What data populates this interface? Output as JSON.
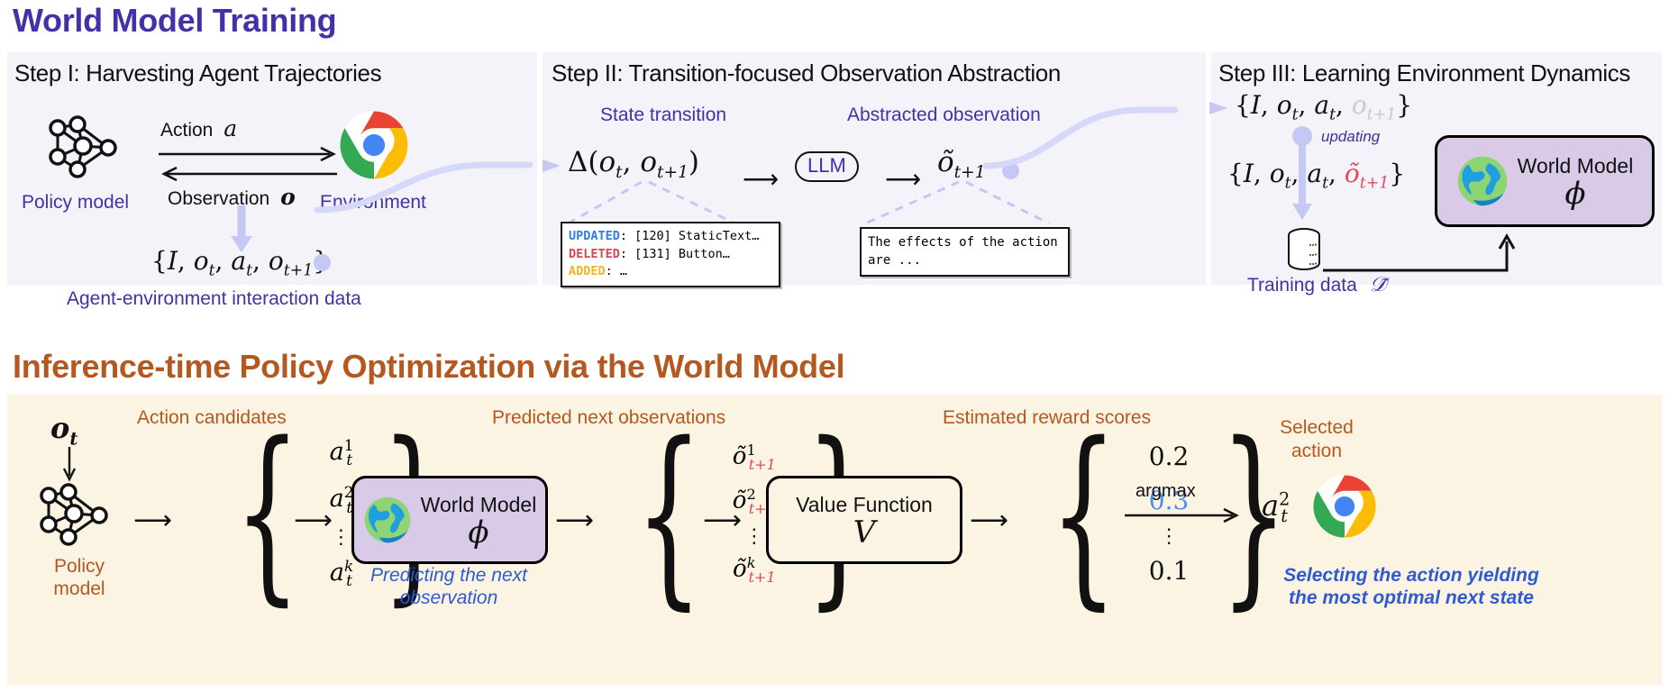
{
  "figure": {
    "top_title": "World Model Training",
    "bottom_title": "Inference-time Policy Optimization via the World Model",
    "colors": {
      "purple": "#4530a8",
      "orange": "#b5581f",
      "panel_bg": "#f4f3fa",
      "band_bg": "#fcf4e2",
      "world_model_box": "#d9cbe8",
      "arrow_lavender": "#c5c8f2",
      "blue_italic": "#2f5bd0",
      "red_accent": "#e1495b",
      "blue_accent": "#4a8cf0"
    }
  },
  "step1": {
    "title": "Step I: Harvesting Agent Trajectories",
    "policy_model_label": "Policy model",
    "environment_label": "Environment",
    "action_label": "Action",
    "action_symbol": "a",
    "observation_label": "Observation",
    "observation_symbol": "o",
    "tuple": "{I, o_t, a_t, o_{t+1}}",
    "caption": "Agent-environment interaction data",
    "icons": {
      "policy": "neural-network-icon",
      "environment": "chrome-browser-icon"
    }
  },
  "step2": {
    "title": "Step II: Transition-focused Observation Abstraction",
    "state_transition_label": "State transition",
    "abstracted_observation_label": "Abstracted observation",
    "delta_expr": "Δ(o_t, o_{t+1})",
    "llm_label": "LLM",
    "output_expr": "õ_{t+1}",
    "diff_box": {
      "lines": [
        {
          "tag": "UPDATED",
          "tag_color": "#2f7fe0",
          "text": ": [120] StaticText…"
        },
        {
          "tag": "DELETED",
          "tag_color": "#dd4455",
          "text": ": [131] Button…"
        },
        {
          "tag": "ADDED",
          "tag_color": "#f0b429",
          "text": ":  …"
        }
      ]
    },
    "abstract_box": {
      "line1": "The effects of the action",
      "line2": "are ..."
    }
  },
  "step3": {
    "title": "Step III: Learning Environment Dynamics",
    "tuple_before": "{I, o_t, a_t, o_{t+1}}",
    "tuple_after": "{I, o_t, a_t, õ_{t+1}}",
    "updating_label": "updating",
    "training_data_label": "Training data",
    "training_data_symbol": "𝒟̃",
    "world_model_title": "World Model",
    "world_model_symbol": "ϕ",
    "icons": {
      "database": "database-icon",
      "globe": "globe-icon"
    }
  },
  "inference": {
    "observation_symbol": "o_t",
    "policy_model_label": "Policy\nmodel",
    "policy_model_line1": "Policy",
    "policy_model_line2": "model",
    "action_candidates_label": "Action candidates",
    "action_candidates": [
      "a¹_t",
      "a²_t",
      "⋮",
      "aᵏ_t"
    ],
    "world_model_title": "World Model",
    "world_model_symbol": "ϕ",
    "world_model_caption_line1": "Predicting the next",
    "world_model_caption_line2": "observation",
    "predicted_label": "Predicted next observations",
    "predicted_observations": [
      "õ¹_{t+1}",
      "õ²_{t+1}",
      "⋮",
      "õᵏ_{t+1}"
    ],
    "value_function_title": "Value Function",
    "value_function_symbol": "V",
    "reward_label": "Estimated reward scores",
    "reward_scores": [
      "0.2",
      "0.3",
      "⋮",
      "0.1"
    ],
    "reward_highlight_index": 1,
    "argmax_label": "argmax",
    "selected_action_label_line1": "Selected",
    "selected_action_label_line2": "action",
    "selected_action_symbol": "a²_t",
    "selection_caption_line1": "Selecting the action yielding",
    "selection_caption_line2": "the most optimal next state",
    "icons": {
      "policy": "neural-network-icon",
      "globe": "globe-icon",
      "browser": "chrome-browser-icon"
    }
  }
}
